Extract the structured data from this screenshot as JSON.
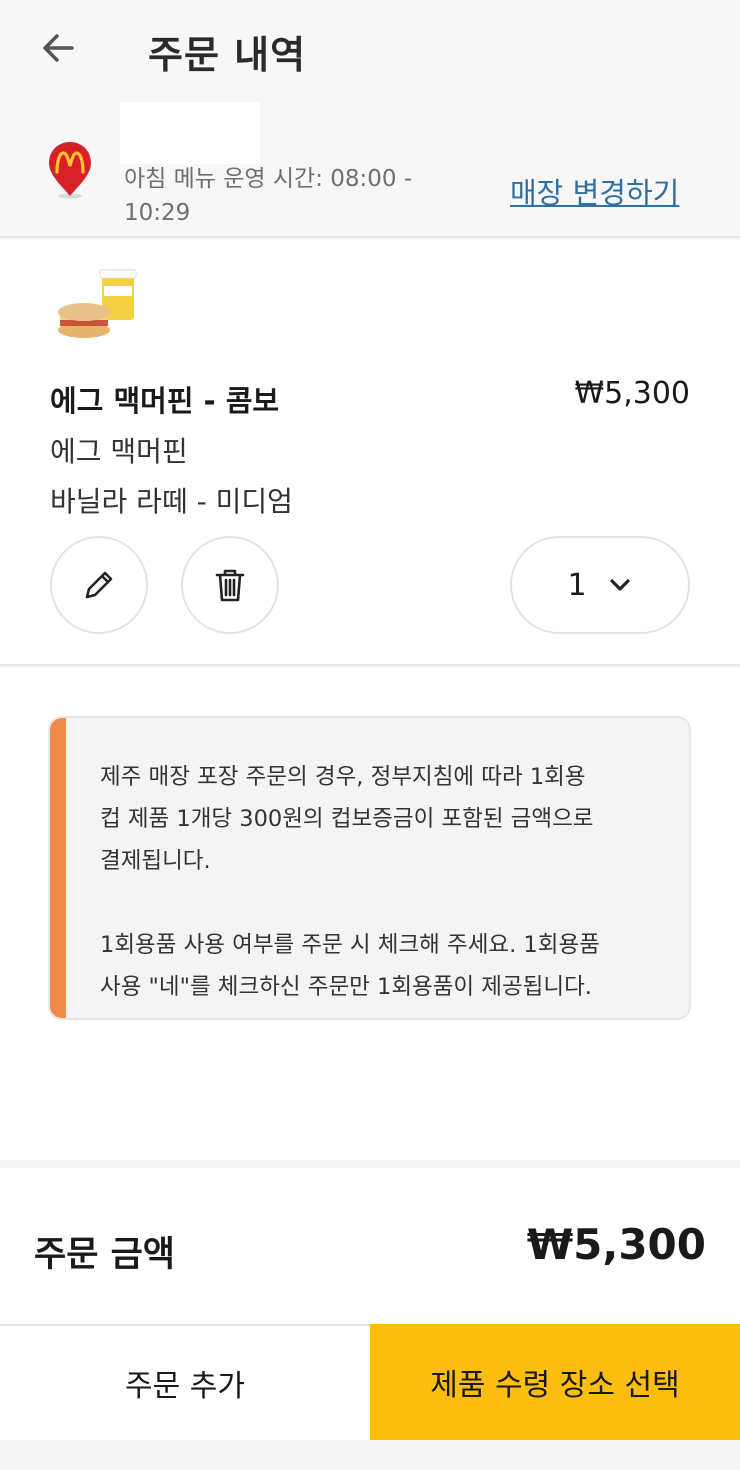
{
  "header": {
    "title": "주문 내역",
    "back_icon": "arrow-left-icon"
  },
  "store": {
    "hours": "아침 메뉴 운영 시간: 08:00 - 10:29",
    "change_link": "매장 변경하기",
    "pin_icon": "mcdonalds-location-pin-icon",
    "link_color": "#2e6fa6"
  },
  "order_item": {
    "image": "egg-mcmuffin-combo-image",
    "name": "에그 맥머핀 - 콤보",
    "price": "₩5,300",
    "components": [
      "에그 맥머핀",
      "바닐라 라떼 - 미디엄"
    ],
    "quantity": "1",
    "edit_icon": "pencil-icon",
    "delete_icon": "trash-icon",
    "quantity_icon": "chevron-down-icon"
  },
  "notice": {
    "paragraph1": "제주 매장 포장 주문의 경우, 정부지침에 따라 1회용\n컵 제품 1개당 300원의 컵보증금이 포함된 금액으로\n결제됩니다.",
    "paragraph2": "1회용품 사용 여부를 주문 시 체크해 주세요. 1회용품\n사용 \"네\"를 체크하신 주문만 1회용품이 제공됩니다.",
    "accent_color": "#f08a49"
  },
  "total": {
    "label": "주문 금액",
    "value": "₩5,300"
  },
  "footer": {
    "add_order": "주문 추가",
    "select_pickup": "제품 수령 장소 선택",
    "primary_color": "#fbbd10"
  }
}
